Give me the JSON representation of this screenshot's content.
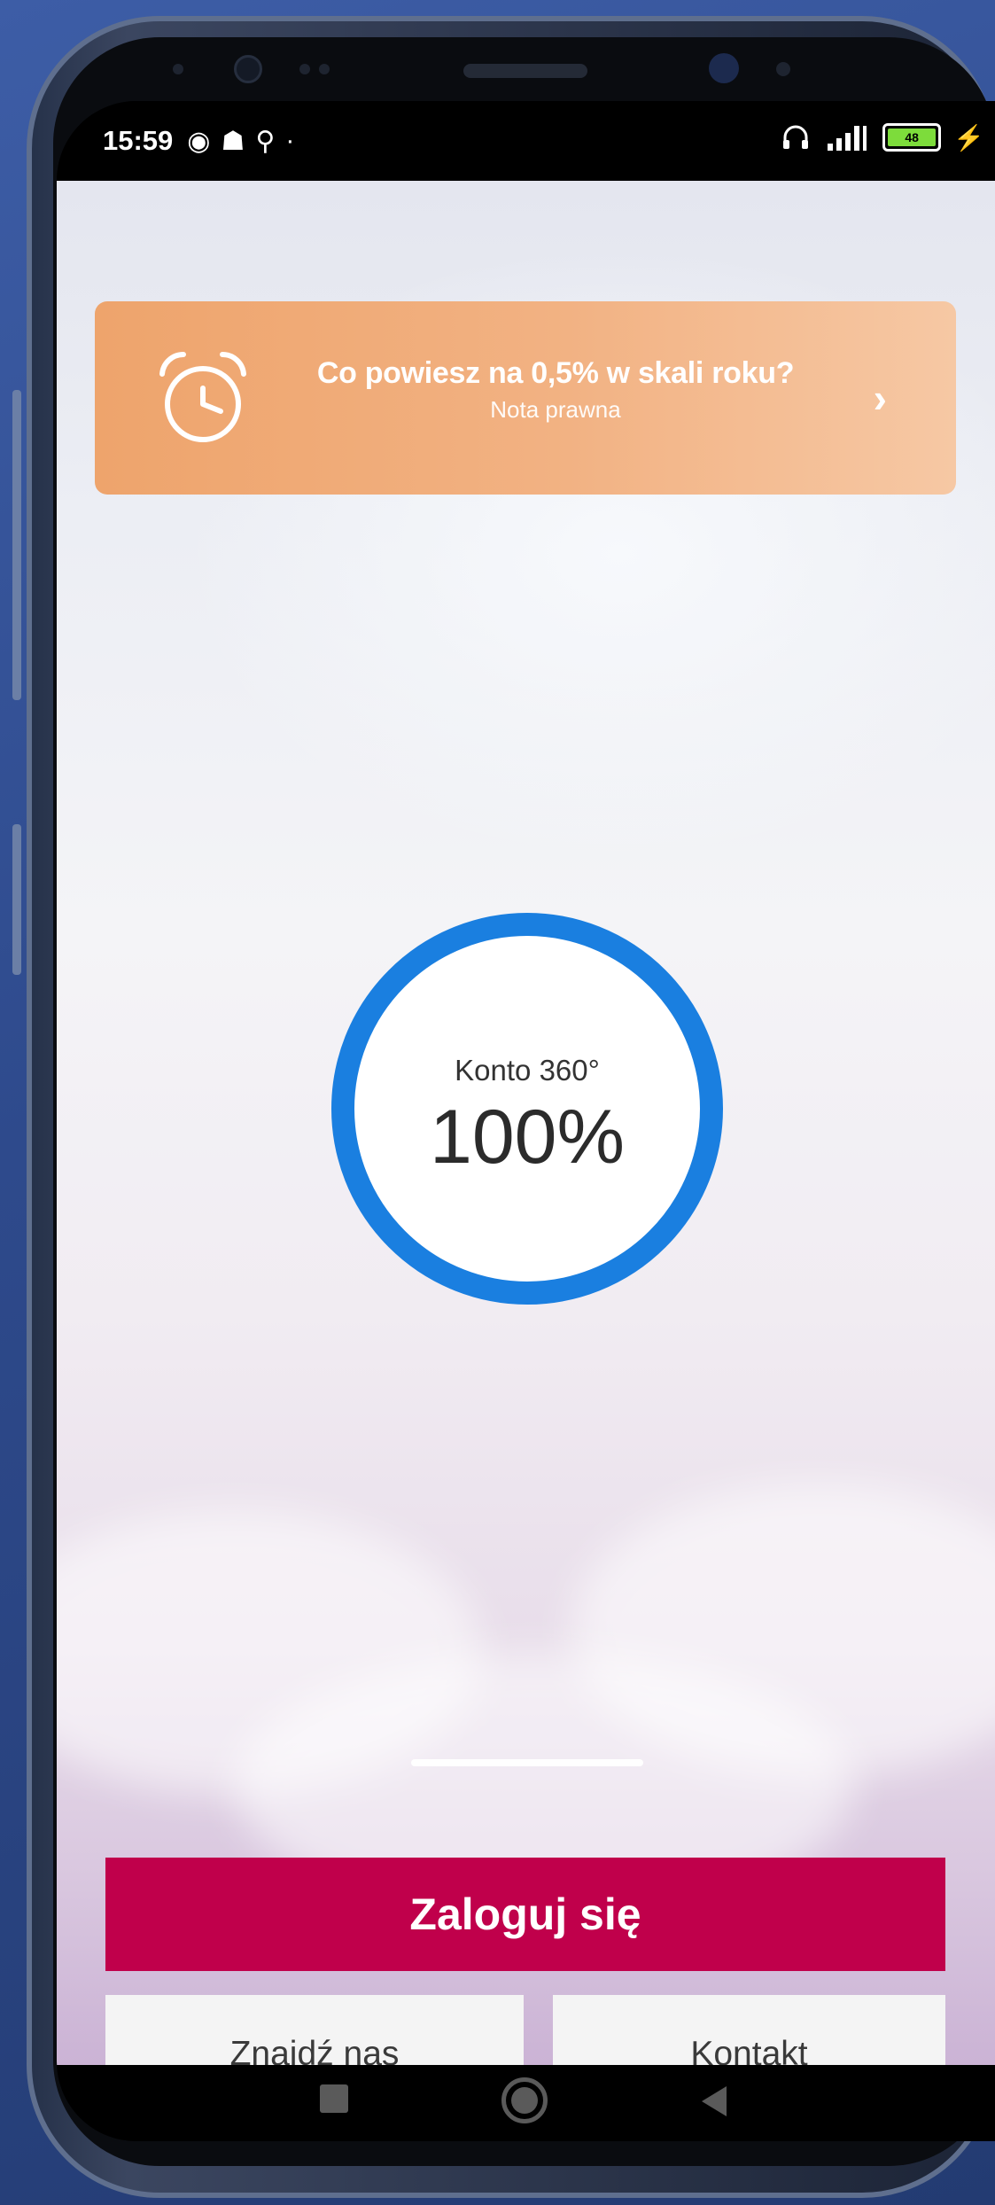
{
  "status_bar": {
    "time": "15:59",
    "left_icons": [
      "spotify-icon",
      "notification-icon",
      "location-icon",
      "dot-icon"
    ],
    "right_icons": [
      "headphones-icon",
      "signal-icon",
      "battery-icon",
      "charging-icon"
    ],
    "battery_label": "48"
  },
  "promo": {
    "title": "Co powiesz na 0,5% w skali roku?",
    "subtitle": "Nota prawna",
    "icon": "alarm-clock-icon",
    "chevron": "›"
  },
  "gauge": {
    "label": "Konto 360°",
    "value_text": "100%",
    "progress": 1.0,
    "color": "#1a7fe0"
  },
  "actions": {
    "login_label": "Zaloguj się",
    "find_us_label": "Znajdź nas",
    "contact_label": "Kontakt"
  },
  "colors": {
    "accent": "#c0004b",
    "promo": "#f0a873",
    "gauge": "#1a7fe0"
  },
  "nav_bar": {
    "icons": [
      "recents-icon",
      "home-icon",
      "back-icon"
    ]
  }
}
